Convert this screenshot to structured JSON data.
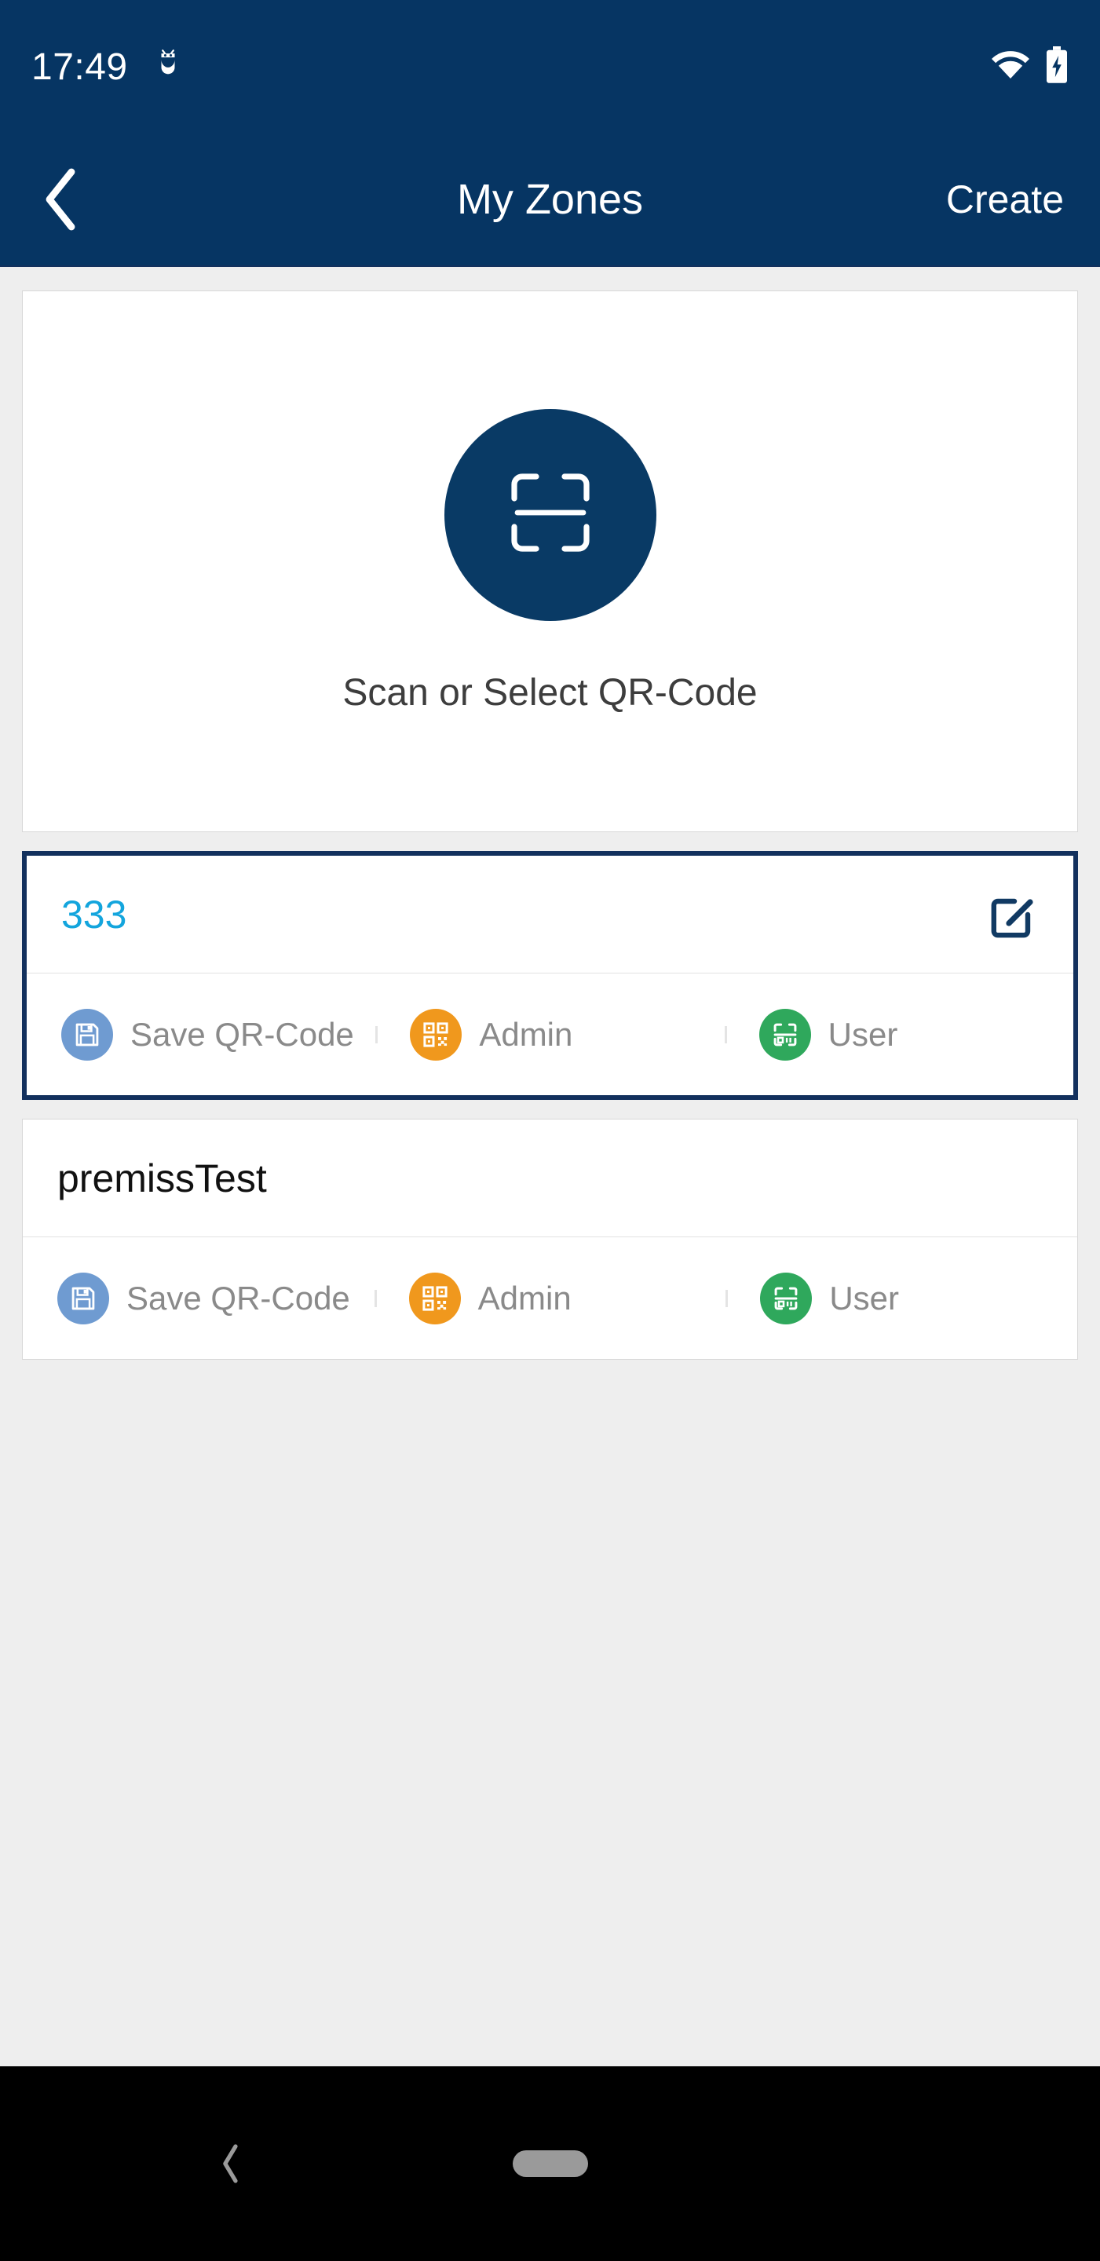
{
  "status_bar": {
    "time": "17:49",
    "icons": [
      "android-debug-icon",
      "wifi-icon",
      "battery-charging-icon"
    ]
  },
  "app_bar": {
    "back_label": "back-chevron",
    "title": "My Zones",
    "action_label": "Create"
  },
  "scan_card": {
    "icon": "qr-scan-frame-icon",
    "label": "Scan or Select QR-Code"
  },
  "zones": [
    {
      "name": "333",
      "selected": true,
      "has_edit": true,
      "edit_icon": "edit-square-pencil-icon",
      "actions": [
        {
          "label": "Save QR-Code",
          "icon": "floppy-save-icon",
          "color": "#6f9bd1"
        },
        {
          "label": "Admin",
          "icon": "qr-code-icon",
          "color": "#f0981d"
        },
        {
          "label": "User",
          "icon": "qr-scan-icon",
          "color": "#2fa85c"
        }
      ]
    },
    {
      "name": "premissTest",
      "selected": false,
      "has_edit": false,
      "edit_icon": "",
      "actions": [
        {
          "label": "Save QR-Code",
          "icon": "floppy-save-icon",
          "color": "#6f9bd1"
        },
        {
          "label": "Admin",
          "icon": "qr-code-icon",
          "color": "#f0981d"
        },
        {
          "label": "User",
          "icon": "qr-scan-icon",
          "color": "#2fa85c"
        }
      ]
    }
  ],
  "nav_bar": {
    "back": "nav-back-icon",
    "home": "nav-home-pill"
  },
  "colors": {
    "brand_navy": "#063563",
    "accent_cyan": "#13a5dd",
    "selected_border": "#12305d",
    "page_bg": "#eeeeee",
    "card_bg": "#ffffff"
  }
}
